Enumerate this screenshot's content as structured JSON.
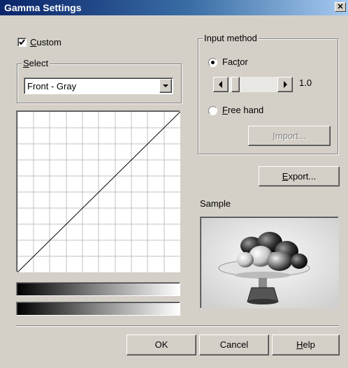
{
  "window": {
    "title": "Gamma Settings",
    "close_glyph": "✕"
  },
  "custom": {
    "label": "Custom",
    "accel": "C",
    "rest": "ustom",
    "checked": true
  },
  "select_group": {
    "legend_accel": "S",
    "legend_rest": "elect",
    "dropdown_value": "Front - Gray"
  },
  "input_method": {
    "legend": "Input method",
    "factor_pre": "Fac",
    "factor_accel": "t",
    "factor_post": "or",
    "factor_selected": true,
    "factor_value": "1.0",
    "slider_level": 0.0,
    "freehand_accel": "F",
    "freehand_rest": "ree hand",
    "import_accel": "I",
    "import_rest": "mport..."
  },
  "export": {
    "accel": "E",
    "rest": "xport..."
  },
  "sample": {
    "label": "Sample"
  },
  "buttons": {
    "ok": "OK",
    "cancel": "Cancel",
    "help_accel": "H",
    "help_rest": "elp"
  },
  "colors": {
    "title_start": "#0a246a",
    "title_end": "#a6caf0",
    "face": "#d4d0c8",
    "disabled_text": "#808080"
  }
}
